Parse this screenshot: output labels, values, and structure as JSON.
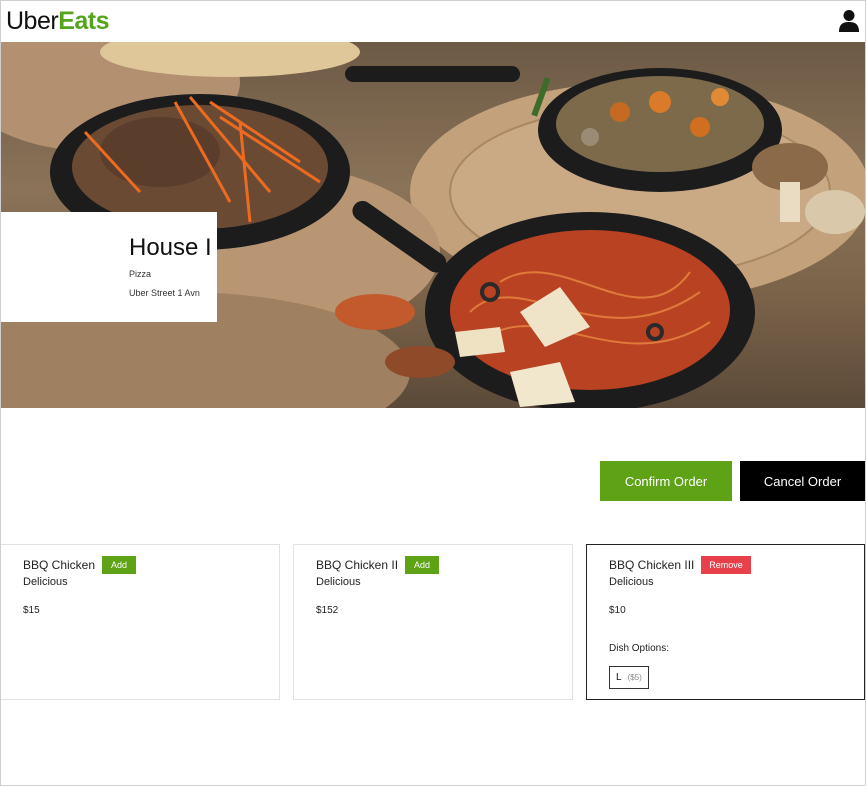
{
  "header": {
    "logo_uber": "Uber",
    "logo_eats": "Eats",
    "user_icon": "user-icon"
  },
  "restaurant": {
    "name": "House I",
    "category": "Pizza",
    "address": "Uber Street 1 Avn"
  },
  "actions": {
    "confirm_label": "Confirm Order",
    "cancel_label": "Cancel Order"
  },
  "dishes": [
    {
      "name": "BBQ Chicken",
      "description": "Delicious",
      "price": "$15",
      "button": "Add"
    },
    {
      "name": "BBQ Chicken II",
      "description": "Delicious",
      "price": "$152",
      "button": "Add"
    },
    {
      "name": "BBQ Chicken III",
      "description": "Delicious",
      "price": "$10",
      "button": "Remove",
      "options_title": "Dish Options:",
      "options": [
        {
          "name": "L",
          "extra": "($5)"
        }
      ]
    }
  ],
  "colors": {
    "brand_green": "#5ea216",
    "logo_green": "#54a51c",
    "remove_red": "#e8404a",
    "cancel_black": "#000000"
  }
}
